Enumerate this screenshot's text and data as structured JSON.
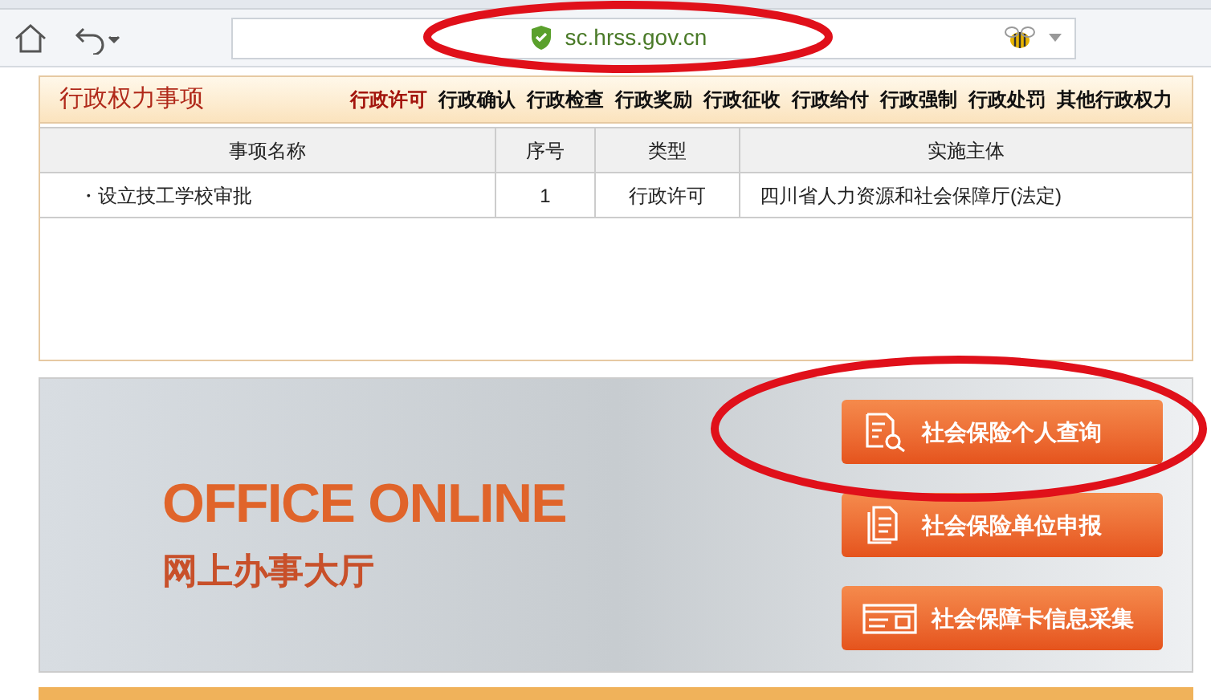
{
  "browser": {
    "address": "sc.hrss.gov.cn"
  },
  "panel": {
    "title": "行政权力事项",
    "tabs": [
      {
        "label": "行政许可",
        "selected": true
      },
      {
        "label": "行政确认",
        "selected": false
      },
      {
        "label": "行政检查",
        "selected": false
      },
      {
        "label": "行政奖励",
        "selected": false
      },
      {
        "label": "行政征收",
        "selected": false
      },
      {
        "label": "行政给付",
        "selected": false
      },
      {
        "label": "行政强制",
        "selected": false
      },
      {
        "label": "行政处罚",
        "selected": false
      },
      {
        "label": "其他行政权力",
        "selected": false
      }
    ],
    "table": {
      "columns": [
        "事项名称",
        "序号",
        "类型",
        "实施主体"
      ],
      "rows": [
        [
          "・设立技工学校审批",
          "1",
          "行政许可",
          "四川省人力资源和社会保障厅(法定)"
        ]
      ]
    }
  },
  "banner": {
    "heading": "OFFICE ONLINE",
    "subheading": "网上办事大厅",
    "buttons": [
      {
        "label": "社会保险个人查询",
        "kind": "search"
      },
      {
        "label": "社会保险单位申报",
        "kind": "document"
      },
      {
        "label": "社会保障卡信息采集",
        "kind": "card"
      }
    ]
  }
}
